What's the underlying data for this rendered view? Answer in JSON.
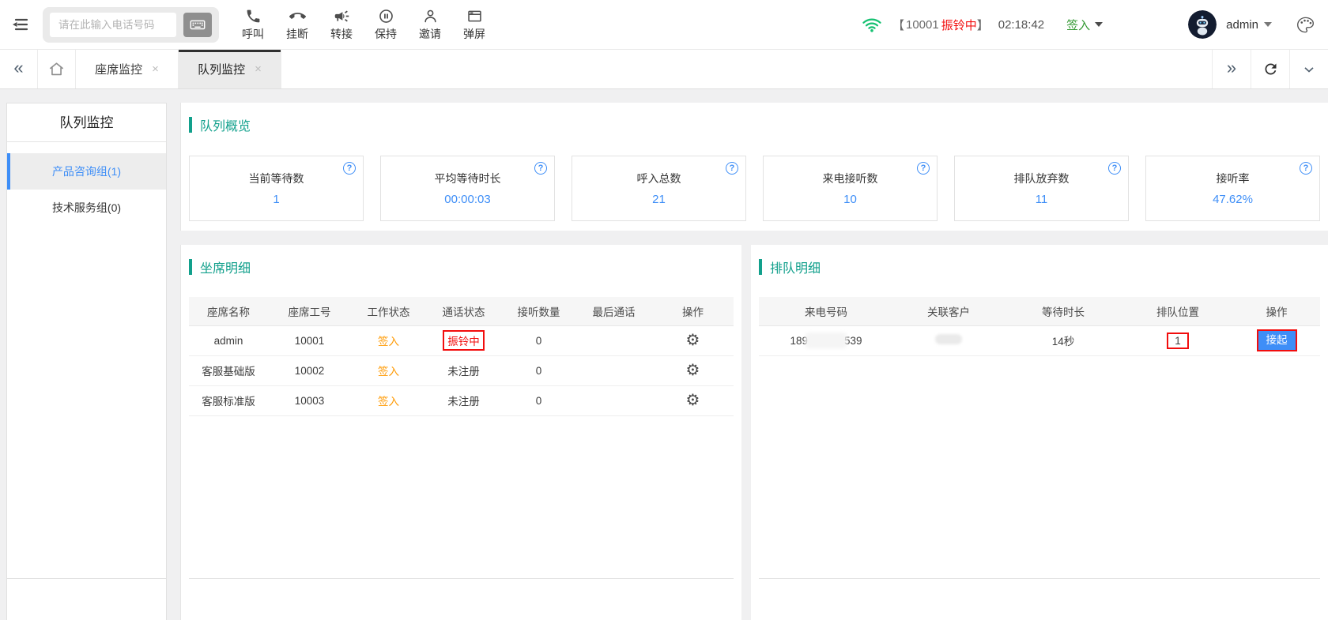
{
  "colors": {
    "accent_blue": "#3e8ef7",
    "section_teal": "#12a08c",
    "alert_red": "#f20d0d",
    "work_state_orange": "#ff9900",
    "checkin_green": "#339933",
    "wifi_green": "#16c172"
  },
  "icons": {
    "gear": "⚙",
    "close": "×",
    "collapse_left": "«",
    "expand_right": "»"
  },
  "topbar": {
    "phone_placeholder": "请在此输入电话号码",
    "actions": [
      {
        "label": "呼叫",
        "icon": "phone-call-icon"
      },
      {
        "label": "挂断",
        "icon": "phone-hangup-icon"
      },
      {
        "label": "转接",
        "icon": "transfer-megaphone-icon"
      },
      {
        "label": "保持",
        "icon": "hold-pause-icon"
      },
      {
        "label": "邀请",
        "icon": "invite-person-icon"
      },
      {
        "label": "弹屏",
        "icon": "popup-screen-icon"
      }
    ],
    "bracket_open": "【",
    "agent_number": "10001",
    "agent_state": "振铃中",
    "bracket_close": "】",
    "call_timer": "02:18:42",
    "checkin_label": "签入",
    "username": "admin"
  },
  "tabbar": {
    "tabs": [
      {
        "label": "座席监控",
        "active": false
      },
      {
        "label": "队列监控",
        "active": true
      }
    ]
  },
  "sidebar": {
    "title": "队列监控",
    "items": [
      {
        "label": "产品咨询组(1)",
        "active": true
      },
      {
        "label": "技术服务组(0)",
        "active": false
      }
    ]
  },
  "overview": {
    "section_title": "队列概览",
    "help_glyph": "?",
    "cards": [
      {
        "label": "当前等待数",
        "value": "1"
      },
      {
        "label": "平均等待时长",
        "value": "00:00:03"
      },
      {
        "label": "呼入总数",
        "value": "21"
      },
      {
        "label": "来电接听数",
        "value": "10"
      },
      {
        "label": "排队放弃数",
        "value": "11"
      },
      {
        "label": "接听率",
        "value": "47.62%"
      }
    ]
  },
  "agents": {
    "section_title": "坐席明细",
    "columns": [
      "座席名称",
      "座席工号",
      "工作状态",
      "通话状态",
      "接听数量",
      "最后通话",
      "操作"
    ],
    "rows": [
      {
        "name": "admin",
        "id": "10001",
        "work_state": "签入",
        "call_state": "振铃中",
        "answered": "0",
        "last_call": ""
      },
      {
        "name": "客服基础版",
        "id": "10002",
        "work_state": "签入",
        "call_state": "未注册",
        "answered": "0",
        "last_call": ""
      },
      {
        "name": "客服标准版",
        "id": "10003",
        "work_state": "签入",
        "call_state": "未注册",
        "answered": "0",
        "last_call": ""
      }
    ]
  },
  "queue": {
    "section_title": "排队明细",
    "columns": [
      "来电号码",
      "关联客户",
      "等待时长",
      "排队位置",
      "操作"
    ],
    "rows": [
      {
        "phone_prefix": "189",
        "phone_suffix": "539",
        "customer": "",
        "wait_time": "14秒",
        "position": "1",
        "action_label": "接起"
      }
    ]
  }
}
